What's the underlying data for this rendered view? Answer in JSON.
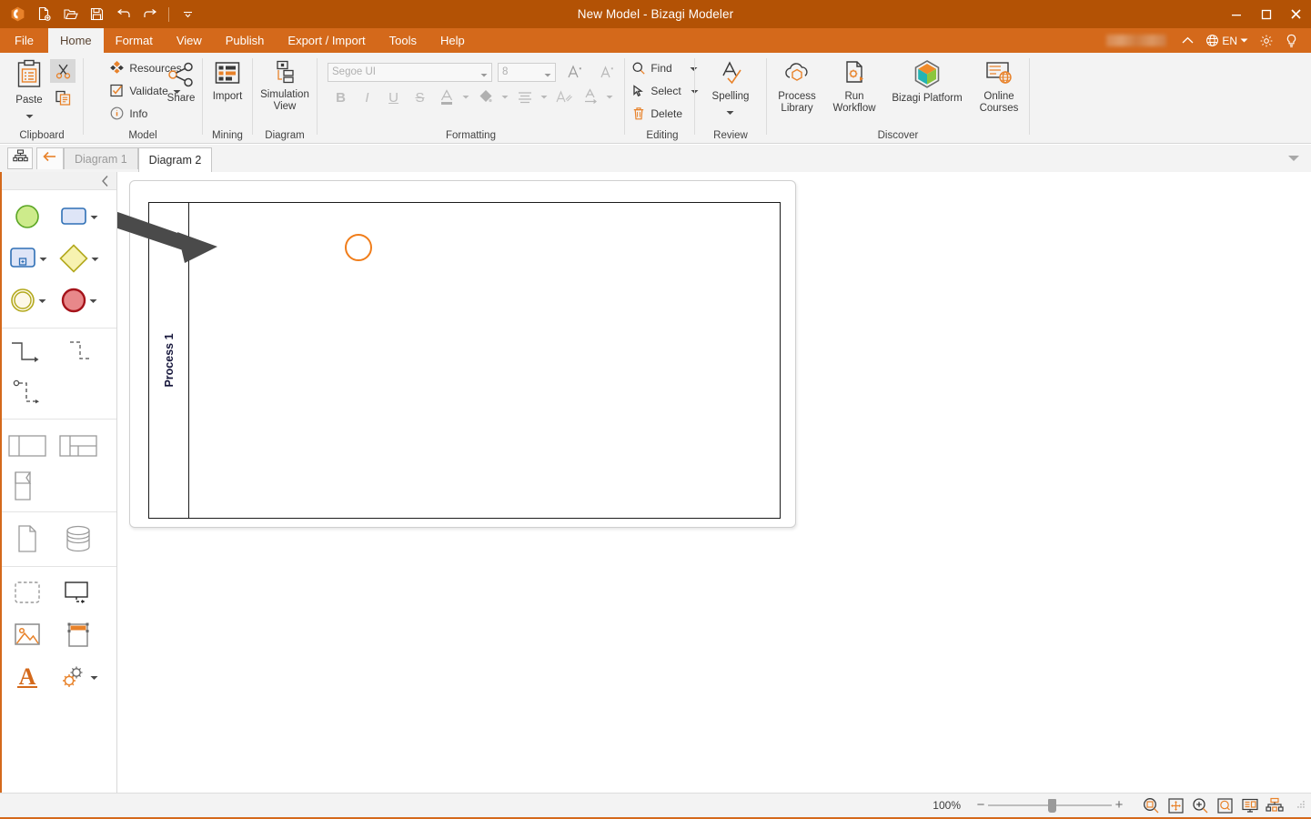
{
  "titlebar": {
    "title": "New Model - Bizagi Modeler",
    "quick_access": [
      {
        "name": "app-logo-icon",
        "label": "Bizagi"
      },
      {
        "name": "new-file-icon",
        "label": "New"
      },
      {
        "name": "open-file-icon",
        "label": "Open"
      },
      {
        "name": "save-icon",
        "label": "Save"
      },
      {
        "name": "undo-icon",
        "label": "Undo"
      },
      {
        "name": "redo-icon",
        "label": "Redo"
      },
      {
        "name": "customize-qat-icon",
        "label": "Customize Quick Access Toolbar"
      }
    ],
    "window_buttons": [
      {
        "name": "minimize-button",
        "label": "Minimize"
      },
      {
        "name": "maximize-button",
        "label": "Maximize"
      },
      {
        "name": "close-button",
        "label": "Close"
      }
    ]
  },
  "ribbon_tabs": {
    "items": [
      {
        "label": "File",
        "active": false
      },
      {
        "label": "Home",
        "active": true
      },
      {
        "label": "Format",
        "active": false
      },
      {
        "label": "View",
        "active": false
      },
      {
        "label": "Publish",
        "active": false
      },
      {
        "label": "Export / Import",
        "active": false
      },
      {
        "label": "Tools",
        "active": false
      },
      {
        "label": "Help",
        "active": false
      }
    ],
    "right": {
      "account_redacted": "",
      "collapse_label": "",
      "language": "EN",
      "settings_label": "",
      "help_label": ""
    }
  },
  "ribbon": {
    "groups": [
      {
        "name": "clipboard",
        "label": "Clipboard",
        "paste_label": "Paste",
        "cut_label": "Cut",
        "copy_label": "Copy"
      },
      {
        "name": "model",
        "label": "Model",
        "items": [
          {
            "label": "Resources",
            "icon": "resources-icon"
          },
          {
            "label": "Validate",
            "icon": "validate-icon"
          },
          {
            "label": "Info",
            "icon": "info-icon"
          }
        ],
        "share_label": "Share"
      },
      {
        "name": "mining",
        "label": "Mining",
        "import_label": "Import"
      },
      {
        "name": "diagram",
        "label": "Diagram",
        "simulation_view_label": "Simulation\nView",
        "simulation_view_line1": "Simulation",
        "simulation_view_line2": "View"
      },
      {
        "name": "formatting",
        "label": "Formatting",
        "font_name": "Segoe UI",
        "font_size": "8",
        "grow_font_label": "A",
        "shrink_font_label": "A",
        "bold_label": "B",
        "italic_label": "I",
        "underline_label": "U",
        "strikethrough_label": "S",
        "font_color_label": "A",
        "fill_color_label": "",
        "align_label": "",
        "format_painter_label": "",
        "text_direction_label": "A"
      },
      {
        "name": "editing",
        "label": "Editing",
        "items": [
          {
            "label": "Find",
            "icon": "search-icon"
          },
          {
            "label": "Select",
            "icon": "cursor-select-icon"
          },
          {
            "label": "Delete",
            "icon": "trash-icon"
          }
        ]
      },
      {
        "name": "review",
        "label": "Review",
        "spelling_label": "Spelling"
      },
      {
        "name": "discover",
        "label": "Discover",
        "items": [
          {
            "line1": "Process",
            "line2": "Library",
            "icon": "cloud-hexagon-icon"
          },
          {
            "line1": "Run",
            "line2": "Workflow",
            "icon": "run-workflow-icon"
          },
          {
            "line1": "Bizagi Platform",
            "line2": "",
            "icon": "bizagi-hexagon-icon"
          },
          {
            "line1": "Online",
            "line2": "Courses",
            "icon": "online-courses-icon"
          }
        ]
      }
    ]
  },
  "doc_tabs": {
    "process_view_label": "",
    "back_label": "",
    "tabs": [
      {
        "label": "Diagram 1",
        "active": false
      },
      {
        "label": "Diagram 2",
        "active": true
      }
    ],
    "collapse_label": ""
  },
  "palette": {
    "collapse_label": "",
    "sections": [
      {
        "name": "events-activities",
        "rows": [
          [
            {
              "name": "start-event-tool",
              "icon": "start-event-circle",
              "dropdown": false
            },
            {
              "name": "task-tool",
              "icon": "task-rounded-rect",
              "dropdown": true
            }
          ],
          [
            {
              "name": "subprocess-tool",
              "icon": "subprocess-rect",
              "dropdown": true
            },
            {
              "name": "gateway-tool",
              "icon": "gateway-diamond",
              "dropdown": true
            }
          ],
          [
            {
              "name": "intermediate-event-tool",
              "icon": "intermediate-event-circle",
              "dropdown": true
            },
            {
              "name": "end-event-tool",
              "icon": "end-event-circle",
              "dropdown": true
            }
          ]
        ]
      },
      {
        "name": "connectors",
        "rows": [
          [
            {
              "name": "sequence-flow-tool",
              "icon": "sequence-flow-arrow",
              "dropdown": false
            },
            {
              "name": "message-flow-tool",
              "icon": "message-flow-dashed",
              "dropdown": false
            }
          ],
          [
            {
              "name": "association-tool",
              "icon": "association-dotted",
              "dropdown": false
            }
          ]
        ]
      },
      {
        "name": "pools-lanes",
        "rows": [
          [
            {
              "name": "pool-tool",
              "icon": "pool-rect",
              "dropdown": false
            },
            {
              "name": "lane-tool",
              "icon": "lane-rect",
              "dropdown": false
            }
          ],
          [
            {
              "name": "milestone-tool",
              "icon": "milestone-shape",
              "dropdown": false
            }
          ]
        ]
      },
      {
        "name": "data",
        "rows": [
          [
            {
              "name": "data-object-tool",
              "icon": "data-object-page",
              "dropdown": false
            },
            {
              "name": "data-store-tool",
              "icon": "data-store-cylinder",
              "dropdown": false
            }
          ]
        ]
      },
      {
        "name": "artifacts",
        "rows": [
          [
            {
              "name": "group-tool",
              "icon": "group-dashed-rect",
              "dropdown": false
            },
            {
              "name": "annotation-tool",
              "icon": "annotation-box",
              "dropdown": false
            }
          ],
          [
            {
              "name": "image-tool",
              "icon": "image-icon",
              "dropdown": false
            },
            {
              "name": "header-tool",
              "icon": "header-icon",
              "dropdown": false
            }
          ],
          [
            {
              "name": "text-tool",
              "icon": "text-a-icon",
              "dropdown": false
            },
            {
              "name": "custom-shapes-tool",
              "icon": "gears-icon",
              "dropdown": true
            }
          ]
        ]
      }
    ]
  },
  "canvas": {
    "pool_label": "Process 1",
    "start_event": {
      "name": "start-event",
      "color": "#f07d1a"
    },
    "annotation_arrow": {
      "name": "pointer-arrow",
      "color": "#4a4a4a"
    }
  },
  "statusbar": {
    "zoom_percent": "100%",
    "zoom_minus": "−",
    "zoom_plus": "+",
    "icons": [
      {
        "name": "zoom-to-selection-icon"
      },
      {
        "name": "fit-to-window-icon"
      },
      {
        "name": "zoom-in-icon"
      },
      {
        "name": "zoom-region-icon"
      },
      {
        "name": "presentation-view-icon"
      },
      {
        "name": "process-tree-view-icon"
      }
    ]
  },
  "colors": {
    "titlebar": "#b35205",
    "ribbon_tabs": "#d4691b",
    "accent": "#d4691b",
    "start_event": "#f07d1a",
    "ribbon_bg": "#f3f3f3"
  }
}
